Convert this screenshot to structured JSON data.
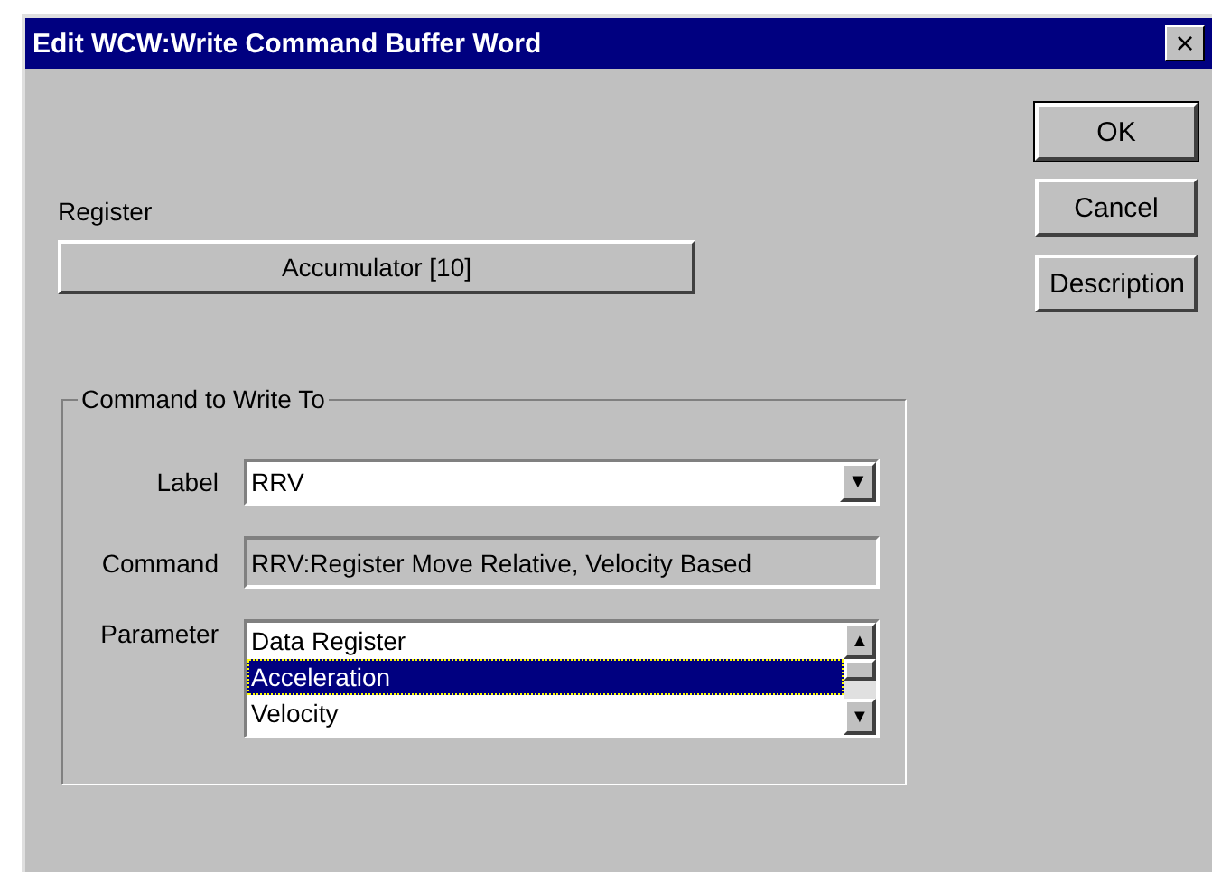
{
  "window": {
    "title": "Edit WCW:Write Command Buffer Word",
    "close": "×"
  },
  "buttons": [
    "OK",
    "Cancel",
    "Description"
  ],
  "register": {
    "label": "Register",
    "value": "Accumulator [10]"
  },
  "group": {
    "title": "Command to Write To",
    "label_field": {
      "label": "Label",
      "value": "RRV",
      "arrow": "▼"
    },
    "command_field": {
      "label": "Command",
      "value": "RRV:Register Move Relative, Velocity Based"
    },
    "parameter": {
      "label": "Parameter",
      "up": "▲",
      "down": "▼",
      "items": [
        {
          "text": "Data Register",
          "selected": false
        },
        {
          "text": "Acceleration",
          "selected": true
        },
        {
          "text": "Velocity",
          "selected": false
        }
      ]
    }
  }
}
